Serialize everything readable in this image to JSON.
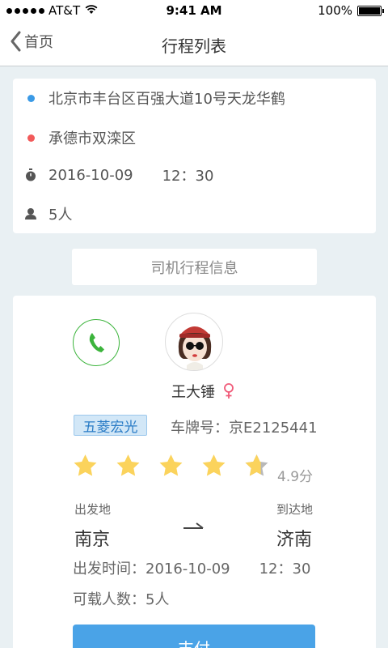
{
  "status_bar": {
    "carrier": "AT&T",
    "time": "9:41 AM",
    "battery": "100%"
  },
  "nav": {
    "back_label": "首页",
    "title": "行程列表"
  },
  "trip": {
    "origin": "北京市丰台区百强大道10号天龙华鹤",
    "destination": "承德市双滦区",
    "date": "2016-10-09",
    "time": "12：30",
    "passengers": "5人"
  },
  "section_tab": "司机行程信息",
  "driver": {
    "name": "王大锤",
    "car_model": "五菱宏光",
    "plate_label": "车牌号：京E2125441",
    "rating_value": 4.9,
    "rating_label": "4.9分",
    "from_label": "出发地",
    "to_label": "到达地",
    "from_city": "南京",
    "to_city": "济南",
    "departure_label": "出发时间：2016-10-09",
    "departure_time": "12：30",
    "capacity_label": "可载人数：5人"
  },
  "pay_label": "支付",
  "colors": {
    "accent": "#4aa3e7",
    "phone_green": "#3cb43c",
    "star": "#fbd35c",
    "female": "#f05a78"
  }
}
